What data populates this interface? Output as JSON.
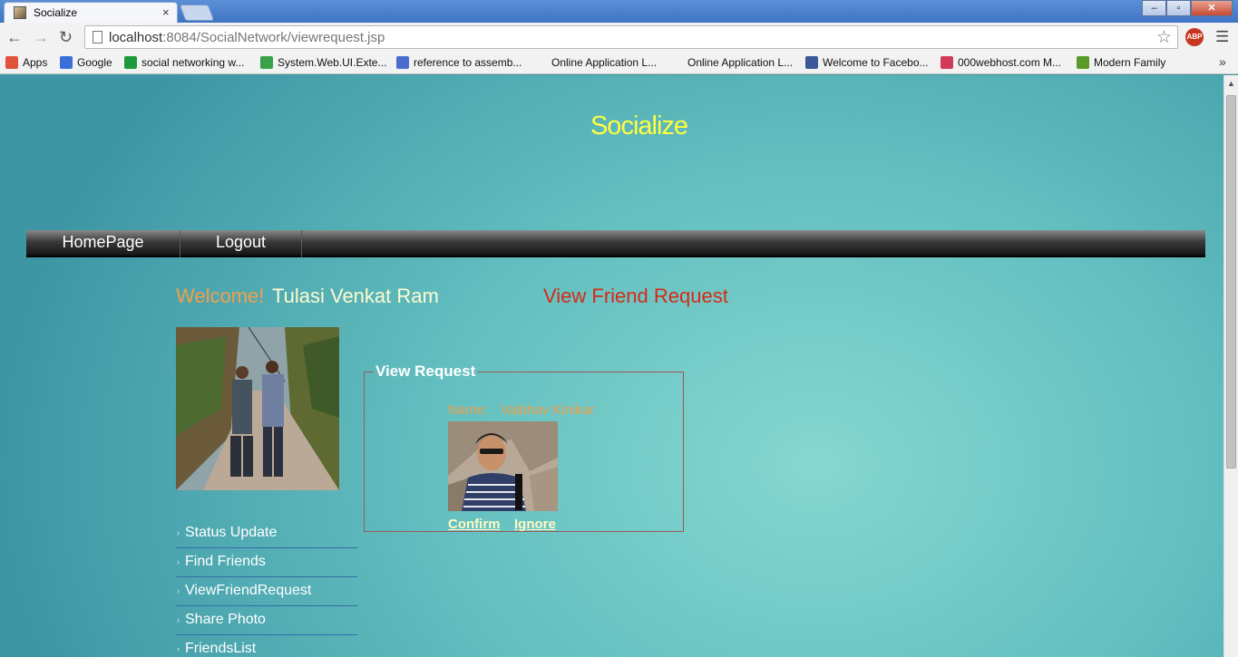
{
  "browser": {
    "tab_title": "Socialize",
    "tab_close": "×",
    "url_host": "localhost",
    "url_rest": ":8084/SocialNetwork/viewrequest.jsp",
    "bookmarks": [
      {
        "label": "Apps",
        "icon": "apps-grid-icon",
        "color": "#e0533a"
      },
      {
        "label": "Google",
        "icon": "google-icon",
        "color": "#3b6fd8"
      },
      {
        "label": "social networking w...",
        "icon": "chevron-green-icon",
        "color": "#1f9a3a"
      },
      {
        "label": "System.Web.UI.Exte...",
        "icon": "check-icon",
        "color": "#3aa14a"
      },
      {
        "label": "reference to assemb...",
        "icon": "diamond-icon",
        "color": "#4a6ed0"
      },
      {
        "label": "Online Application L...",
        "icon": "",
        "color": ""
      },
      {
        "label": "Online Application L...",
        "icon": "",
        "color": ""
      },
      {
        "label": "Welcome to Facebo...",
        "icon": "facebook-icon",
        "color": "#3b5998"
      },
      {
        "label": "000webhost.com M...",
        "icon": "webhost-icon",
        "color": "#d23a5a"
      },
      {
        "label": "Modern Family",
        "icon": "tree-icon",
        "color": "#5a9a2a"
      }
    ],
    "bookmarks_more": "»"
  },
  "site": {
    "title": "Socialize",
    "nav": [
      "HomePage",
      "Logout"
    ],
    "welcome_label": "Welcome!",
    "username": "Tulasi Venkat Ram",
    "page_heading": "View Friend Request",
    "side_menu": [
      "Status Update",
      "Find Friends",
      "ViewFriendRequest",
      "Share Photo",
      "FriendsList"
    ]
  },
  "request": {
    "legend": "View Request",
    "name_label": "Name:",
    "name_value": "Vaibhav Kinikar",
    "confirm": "Confirm",
    "ignore": "Ignore"
  }
}
